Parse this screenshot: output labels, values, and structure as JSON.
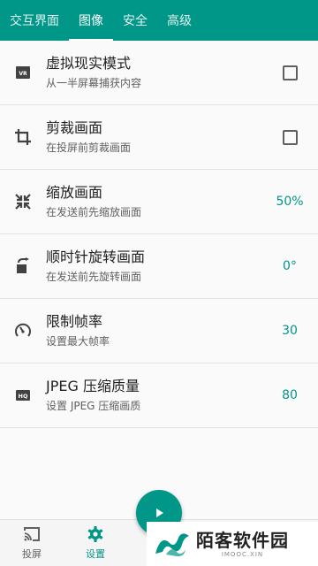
{
  "tabs": [
    {
      "label": "交互界面"
    },
    {
      "label": "图像"
    },
    {
      "label": "安全"
    },
    {
      "label": "高级"
    }
  ],
  "settings": [
    {
      "title": "虚拟现实模式",
      "subtitle": "从一半屏幕捕获内容",
      "icon": "vr-icon",
      "checked": false
    },
    {
      "title": "剪裁画面",
      "subtitle": "在投屏前剪裁画面",
      "icon": "crop-icon",
      "checked": false
    },
    {
      "title": "缩放画面",
      "subtitle": "在发送前先缩放画面",
      "icon": "scale-icon",
      "value": "50%"
    },
    {
      "title": "顺时针旋转画面",
      "subtitle": "在发送前先旋转画面",
      "icon": "rotate-icon",
      "value": "0°"
    },
    {
      "title": "限制帧率",
      "subtitle": "设置最大帧率",
      "icon": "speedometer-icon",
      "value": "30"
    },
    {
      "title": "JPEG 压缩质量",
      "subtitle": "设置 JPEG 压缩画质",
      "icon": "hq-icon",
      "value": "80"
    }
  ],
  "bottom_nav": [
    {
      "label": "投屏",
      "icon": "cast-icon"
    },
    {
      "label": "设置",
      "icon": "gear-icon"
    }
  ],
  "fab": {
    "icon": "play-icon"
  },
  "watermark": {
    "main": "陌客软件园",
    "sub": "IMOOC.XIN"
  },
  "colors": {
    "accent": "#009688",
    "background": "#fafafa"
  }
}
